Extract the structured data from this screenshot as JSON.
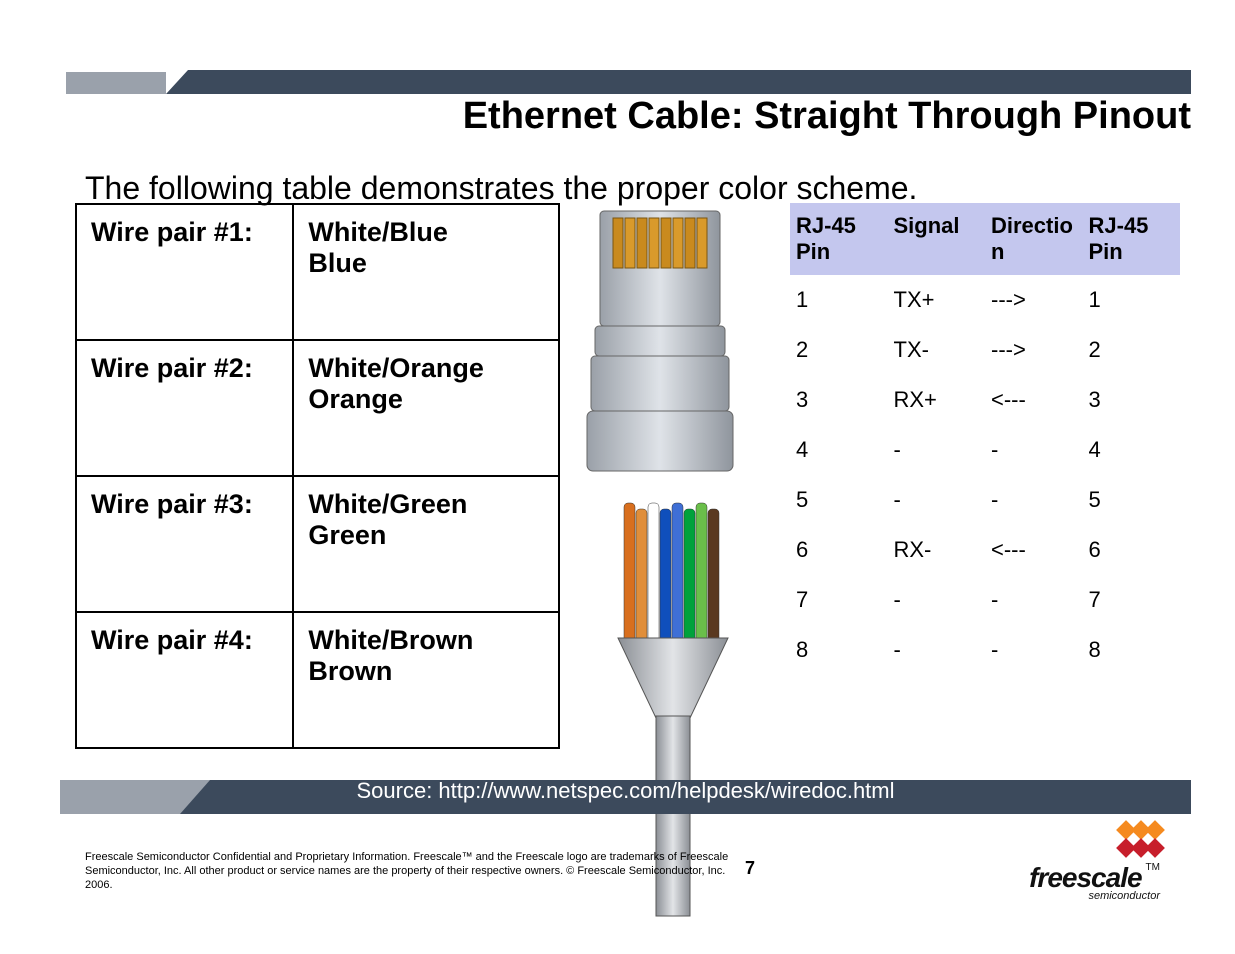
{
  "title": "Ethernet Cable: Straight Through Pinout",
  "intro": "The following table demonstrates the proper color scheme.",
  "wire_pairs": [
    {
      "label": "Wire pair #1:",
      "colors": "White/Blue\nBlue"
    },
    {
      "label": "Wire pair #2:",
      "colors": "White/Orange\nOrange"
    },
    {
      "label": "Wire pair #3:",
      "colors": "White/Green\nGreen"
    },
    {
      "label": "Wire pair #4:",
      "colors": "White/Brown\nBrown"
    }
  ],
  "pinout": {
    "headers": [
      "RJ-45 Pin",
      "Signal",
      "Direction",
      "RJ-45 Pin"
    ],
    "rows": [
      [
        "1",
        "TX+",
        "--->",
        "1"
      ],
      [
        "2",
        "TX-",
        "--->",
        "2"
      ],
      [
        "3",
        "RX+",
        "<---",
        "3"
      ],
      [
        "4",
        "-",
        "-",
        "4"
      ],
      [
        "5",
        "-",
        "-",
        "5"
      ],
      [
        "6",
        "RX-",
        "<---",
        "6"
      ],
      [
        "7",
        "-",
        "-",
        "7"
      ],
      [
        "8",
        "-",
        "-",
        "8"
      ]
    ]
  },
  "source": "Source: http://www.netspec.com/helpdesk/wiredoc.html",
  "page": "7",
  "disclaimer": "Freescale Semiconductor Confidential and Proprietary Information. Freescale™ and the Freescale logo are trademarks of Freescale Semiconductor, Inc. All other product or service names are the property of their respective owners. © Freescale Semiconductor, Inc. 2006.",
  "logo": {
    "name": "freescale",
    "sub": "semiconductor",
    "tm": "TM"
  },
  "cable_colors": {
    "wires": [
      "#d86f1e",
      "#e08e3a",
      "#ffffff",
      "#0f4fbc",
      "#3f6fd6",
      "#00a23c",
      "#6abf4a",
      "#5a3920"
    ]
  }
}
